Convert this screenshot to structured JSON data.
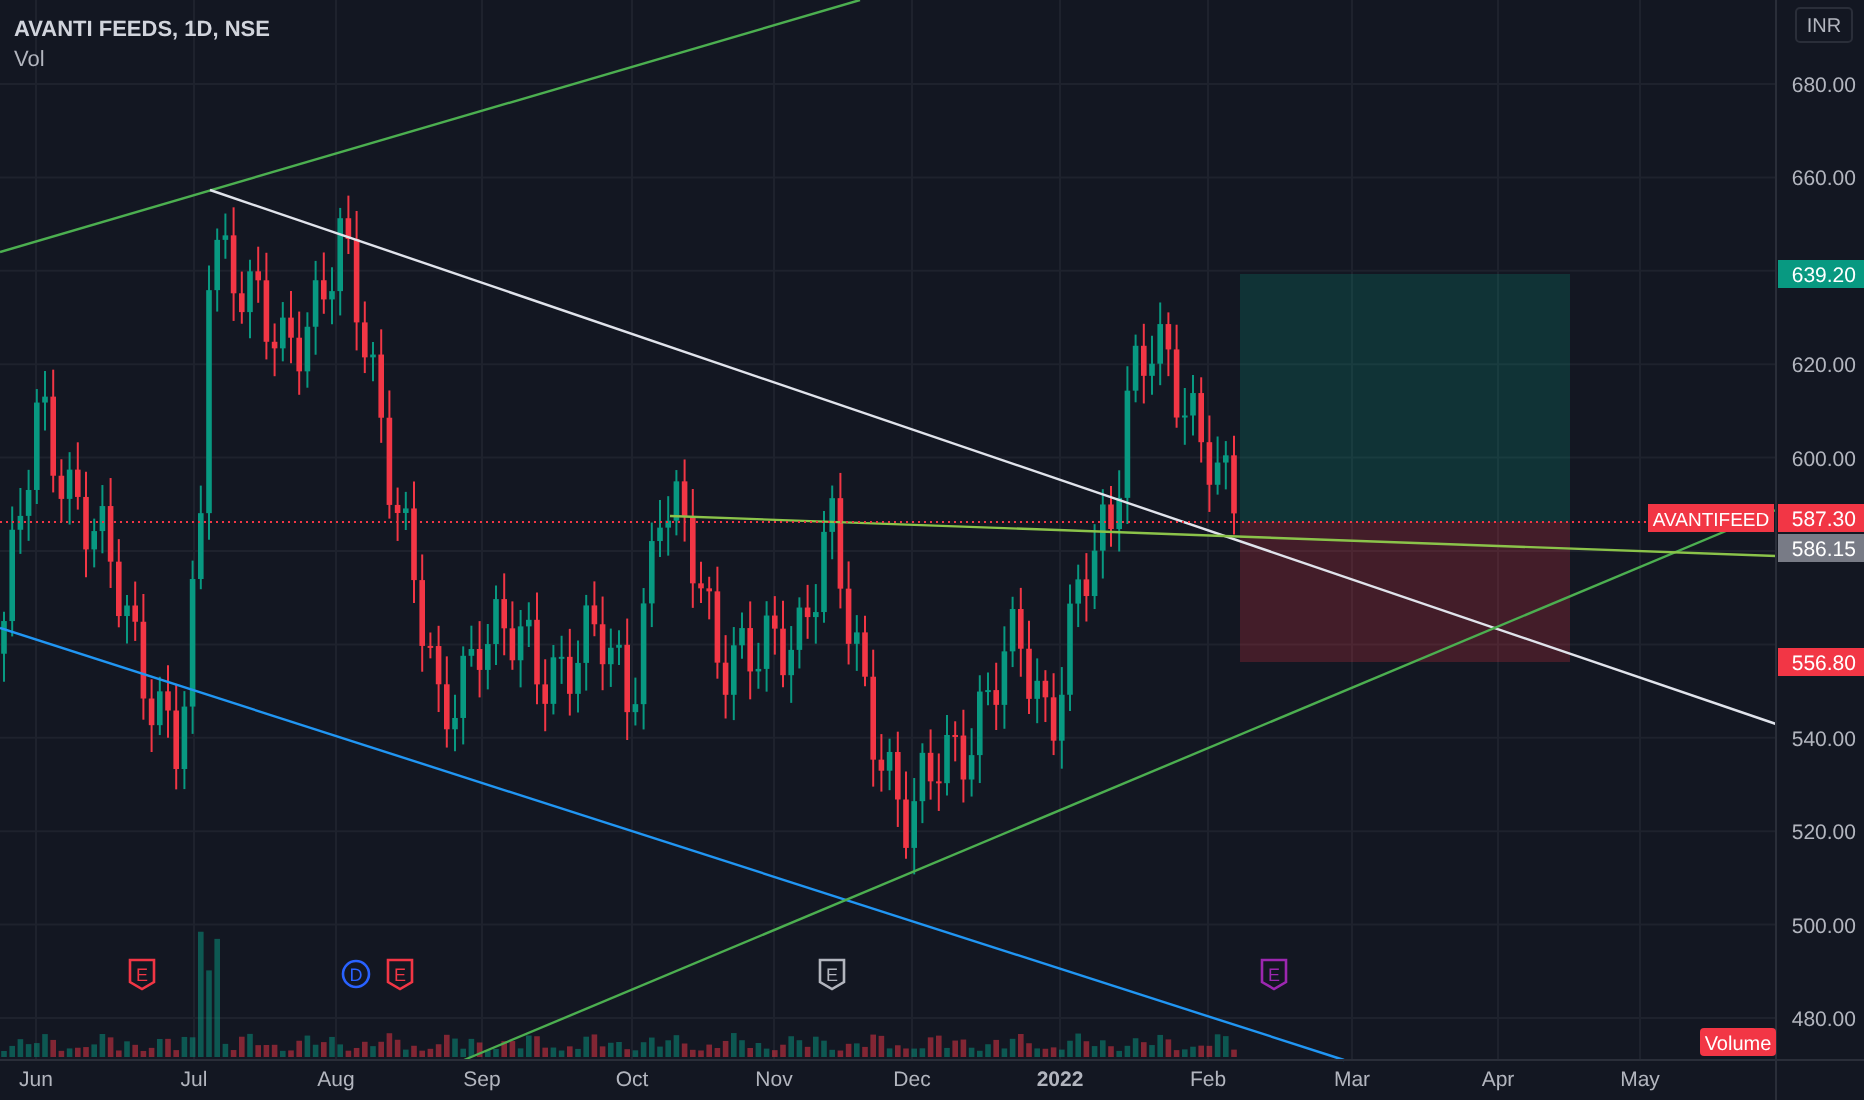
{
  "header": {
    "title": "AVANTI FEEDS, 1D, NSE",
    "indicator": "Vol"
  },
  "currency": "INR",
  "price_axis": [
    "680.00",
    "660.00",
    "620.00",
    "600.00",
    "540.00",
    "520.00",
    "500.00",
    "480.00"
  ],
  "price_labels": [
    {
      "kind": "target",
      "text": "639.20",
      "color": "#089981"
    },
    {
      "kind": "last",
      "symbol": "AVANTIFEED",
      "text": "587.30",
      "color": "#f23645"
    },
    {
      "kind": "level",
      "text": "586.15",
      "color": "#787b86"
    },
    {
      "kind": "stop",
      "text": "556.80",
      "color": "#f23645"
    }
  ],
  "time_axis": [
    {
      "text": "Jun",
      "bold": false
    },
    {
      "text": "Jul",
      "bold": false
    },
    {
      "text": "Aug",
      "bold": false
    },
    {
      "text": "Sep",
      "bold": false
    },
    {
      "text": "Oct",
      "bold": false
    },
    {
      "text": "Nov",
      "bold": false
    },
    {
      "text": "Dec",
      "bold": false
    },
    {
      "text": "2022",
      "bold": true
    },
    {
      "text": "Feb",
      "bold": false
    },
    {
      "text": "Mar",
      "bold": false
    },
    {
      "text": "Apr",
      "bold": false
    },
    {
      "text": "May",
      "bold": false
    }
  ],
  "events": [
    {
      "text": "E",
      "kind": "earnings",
      "color": "#f23645"
    },
    {
      "text": "D",
      "kind": "dividend",
      "color": "#2962ff"
    },
    {
      "text": "E",
      "kind": "earnings",
      "color": "#f23645"
    },
    {
      "text": "E",
      "kind": "earnings",
      "color": "#b2b5be"
    },
    {
      "text": "E",
      "kind": "earnings",
      "color": "#9c27b0"
    }
  ],
  "volume_label": "Volume"
}
